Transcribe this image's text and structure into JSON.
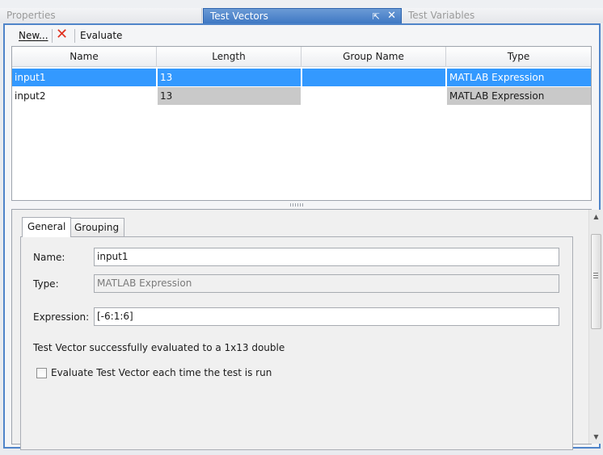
{
  "tabs": {
    "properties": "Properties",
    "test_vectors": "Test Vectors",
    "test_variables": "Test Variables"
  },
  "icons": {
    "pin": "⇱",
    "close": "✕",
    "delete": "✕"
  },
  "toolbar": {
    "new_label": "New...",
    "evaluate_label": "Evaluate"
  },
  "table": {
    "columns": [
      "Name",
      "Length",
      "Group Name",
      "Type"
    ],
    "rows": [
      {
        "name": "input1",
        "length": "13",
        "group": "",
        "type": "MATLAB Expression"
      },
      {
        "name": "input2",
        "length": "13",
        "group": "",
        "type": "MATLAB Expression"
      }
    ],
    "selected_row": 0
  },
  "details": {
    "tabs": [
      "General",
      "Grouping"
    ],
    "name_label": "Name:",
    "name_value": "input1",
    "type_label": "Type:",
    "type_value": "MATLAB Expression",
    "expression_label": "Expression:",
    "expression_value": "[-6:1:6]",
    "status_text": "Test Vector successfully evaluated to a 1x13 double",
    "checkbox_label": "Evaluate Test Vector each time the test is run",
    "checkbox_checked": false
  },
  "colors": {
    "accent": "#4f84c9",
    "selection": "#3399ff",
    "delete_red": "#e0301e"
  }
}
